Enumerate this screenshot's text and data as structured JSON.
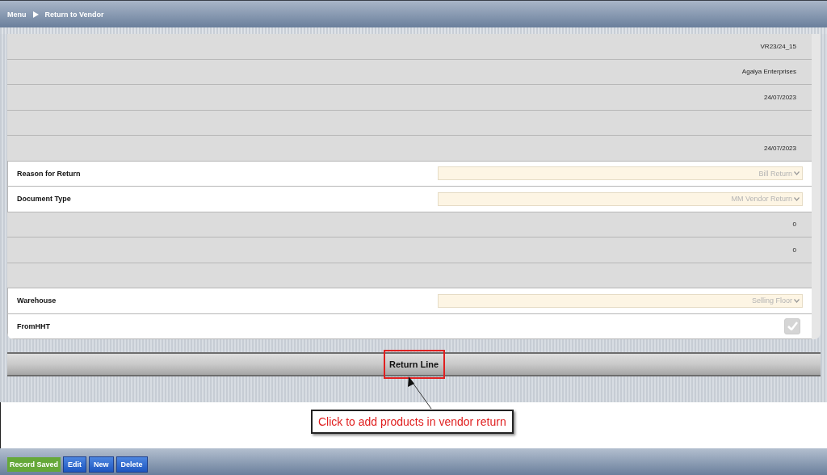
{
  "breadcrumb": {
    "items": [
      "Menu",
      "Return to Vendor"
    ]
  },
  "rows": [
    {
      "kind": "value",
      "value": "VR23/24_15"
    },
    {
      "kind": "value",
      "value": "Agalya Enterprises"
    },
    {
      "kind": "value",
      "value": "24/07/2023"
    },
    {
      "kind": "blank"
    },
    {
      "kind": "value",
      "value": "24/07/2023"
    },
    {
      "kind": "select",
      "label": "Reason for Return",
      "value": "Bill Return",
      "disabled": true
    },
    {
      "kind": "select",
      "label": "Document Type",
      "value": "MM Vendor Return",
      "disabled": true
    },
    {
      "kind": "value",
      "value": "0"
    },
    {
      "kind": "value",
      "value": "0"
    },
    {
      "kind": "blank"
    },
    {
      "kind": "select",
      "label": "Warehouse",
      "value": "Selling Floor",
      "disabled": true
    },
    {
      "kind": "checkbox",
      "label": "FromHHT",
      "checked": true
    }
  ],
  "return_line_button": "Return Line",
  "annotation": "Click to add products in vendor return",
  "footer": {
    "status": "Record Saved",
    "buttons": [
      "Edit",
      "New",
      "Delete"
    ]
  }
}
